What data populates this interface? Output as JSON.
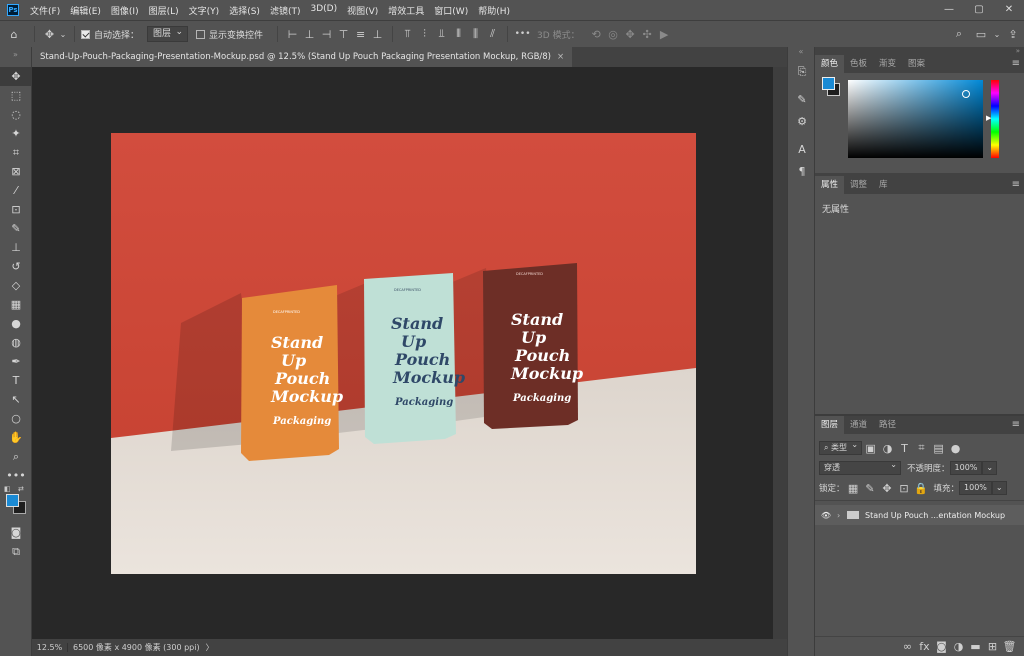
{
  "app_icon": "Ps",
  "menu": [
    "文件(F)",
    "编辑(E)",
    "图像(I)",
    "图层(L)",
    "文字(Y)",
    "选择(S)",
    "滤镜(T)",
    "3D(D)",
    "视图(V)",
    "增效工具",
    "窗口(W)",
    "帮助(H)"
  ],
  "window_controls": {
    "minimize": "—",
    "restore": "▢",
    "close": "✕"
  },
  "options": {
    "auto_select_label": "自动选择：",
    "auto_select_value": "图层",
    "show_transform_label": "显示变换控件",
    "mode_3d_label": "3D 模式：",
    "more": "•••"
  },
  "document_tab": {
    "title": "Stand-Up-Pouch-Packaging-Presentation-Mockup.psd @ 12.5% (Stand Up Pouch Packaging Presentation Mockup, RGB/8)",
    "close": "×"
  },
  "status": {
    "zoom": "12.5%",
    "info": "6500 像素 x 4900 像素 (300 ppi)",
    "arrow": "〉"
  },
  "colors": {
    "foreground": "#1a8ad4",
    "background": "#1e1e1e",
    "accent": "#31a8ff"
  },
  "color_panel": {
    "tabs": [
      "颜色",
      "色板",
      "渐变",
      "图案"
    ],
    "active": 0
  },
  "properties_panel": {
    "tabs": [
      "属性",
      "调整",
      "库"
    ],
    "active": 0,
    "content": "无属性"
  },
  "layers_panel": {
    "tabs": [
      "图层",
      "通道",
      "路径"
    ],
    "active": 0,
    "filter_label": "类型",
    "blend_mode": "穿透",
    "opacity_label": "不透明度：",
    "opacity": "100%",
    "lock_label": "锁定：",
    "fill_label": "填充：",
    "fill": "100%",
    "layers": [
      {
        "name": "Stand Up Pouch ...entation Mockup",
        "visible": true,
        "type": "group"
      }
    ]
  },
  "mockup": {
    "brand": "DECAFPRINTED",
    "pouch_text": [
      "Stand",
      "Up",
      "Pouch",
      "Mockup",
      "Packaging"
    ],
    "pouch_colors": [
      "#e58a3a",
      "#bfe0d6",
      "#6d2e26"
    ],
    "wall_color": "#cf4a3b",
    "floor_color": "#e6ded6"
  }
}
